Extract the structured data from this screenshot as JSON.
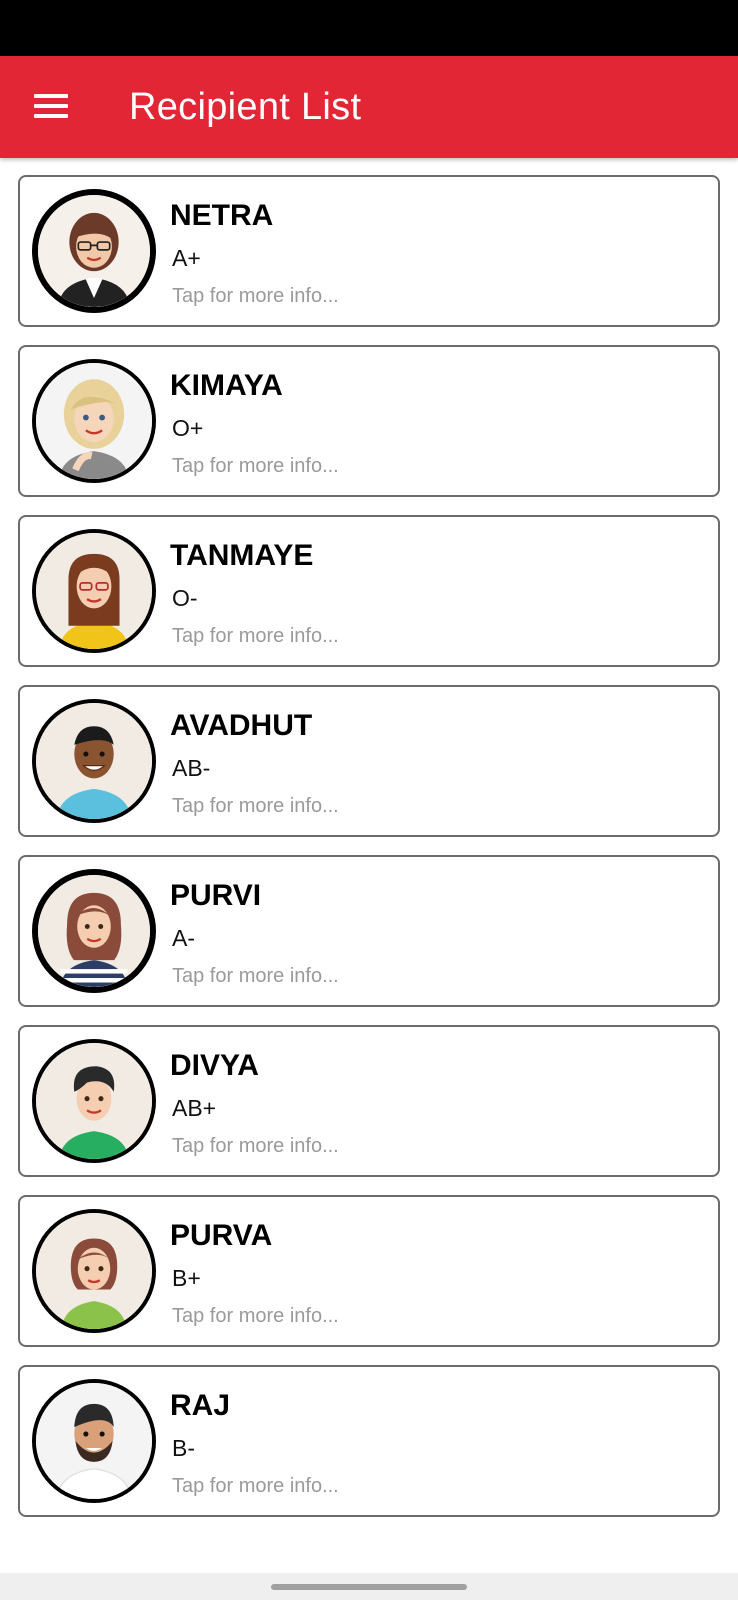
{
  "app_bar": {
    "title": "Recipient List",
    "menu_icon": "hamburger-menu-icon",
    "color": "#e32636"
  },
  "recipients": [
    {
      "name": "NETRA",
      "blood_group": "A+",
      "hint": "Tap for more info..."
    },
    {
      "name": "KIMAYA",
      "blood_group": "O+",
      "hint": "Tap for more info..."
    },
    {
      "name": "TANMAYE",
      "blood_group": "O-",
      "hint": "Tap for more info..."
    },
    {
      "name": "AVADHUT",
      "blood_group": "AB-",
      "hint": "Tap for more info..."
    },
    {
      "name": "PURVI",
      "blood_group": "A-",
      "hint": "Tap for more info..."
    },
    {
      "name": "DIVYA",
      "blood_group": "AB+",
      "hint": "Tap for more info..."
    },
    {
      "name": "PURVA",
      "blood_group": "B+",
      "hint": "Tap for more info..."
    },
    {
      "name": "RAJ",
      "blood_group": "B-",
      "hint": "Tap for more info..."
    }
  ]
}
